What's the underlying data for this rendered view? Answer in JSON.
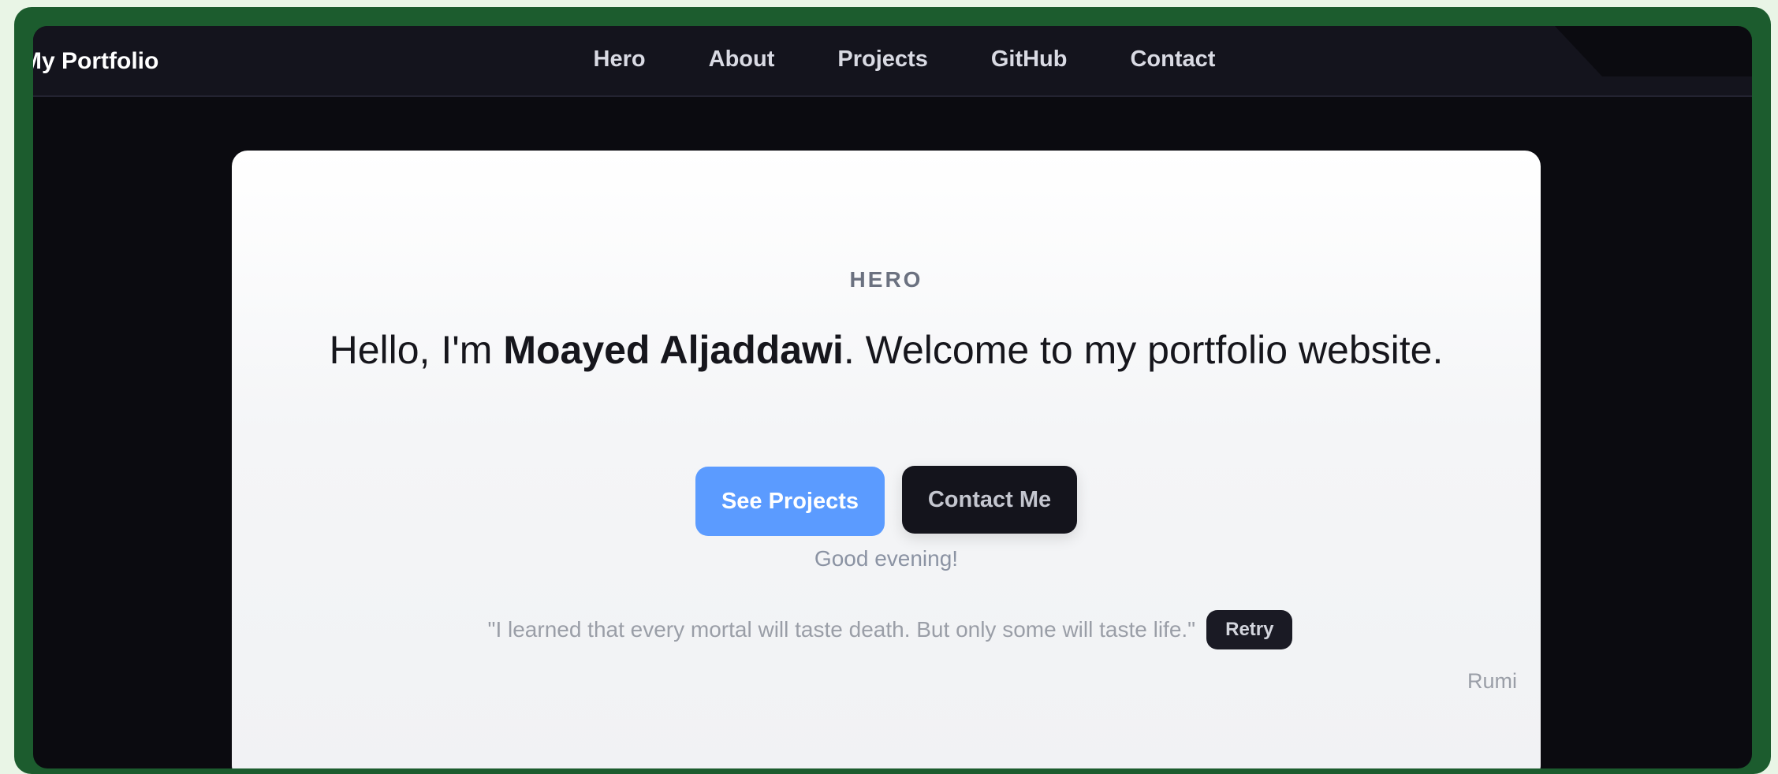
{
  "header": {
    "brand": "My Portfolio",
    "nav": [
      {
        "label": "Hero"
      },
      {
        "label": "About"
      },
      {
        "label": "Projects"
      },
      {
        "label": "GitHub"
      },
      {
        "label": "Contact"
      }
    ]
  },
  "hero": {
    "eyebrow": "HERO",
    "headline_prefix": "Hello, I'm ",
    "name": "Moayed Aljaddawi",
    "headline_suffix": ". Welcome to my portfolio website.",
    "primary_button": "See Projects",
    "secondary_button": "Contact Me",
    "greeting": "Good evening!",
    "quote": "\"I learned that every mortal will taste death. But only some will taste life.\"",
    "retry_button": "Retry",
    "author": "Rumi"
  },
  "colors": {
    "primary": "#5b9bff",
    "frame": "#1c5c2e",
    "dark": "#14141c"
  }
}
